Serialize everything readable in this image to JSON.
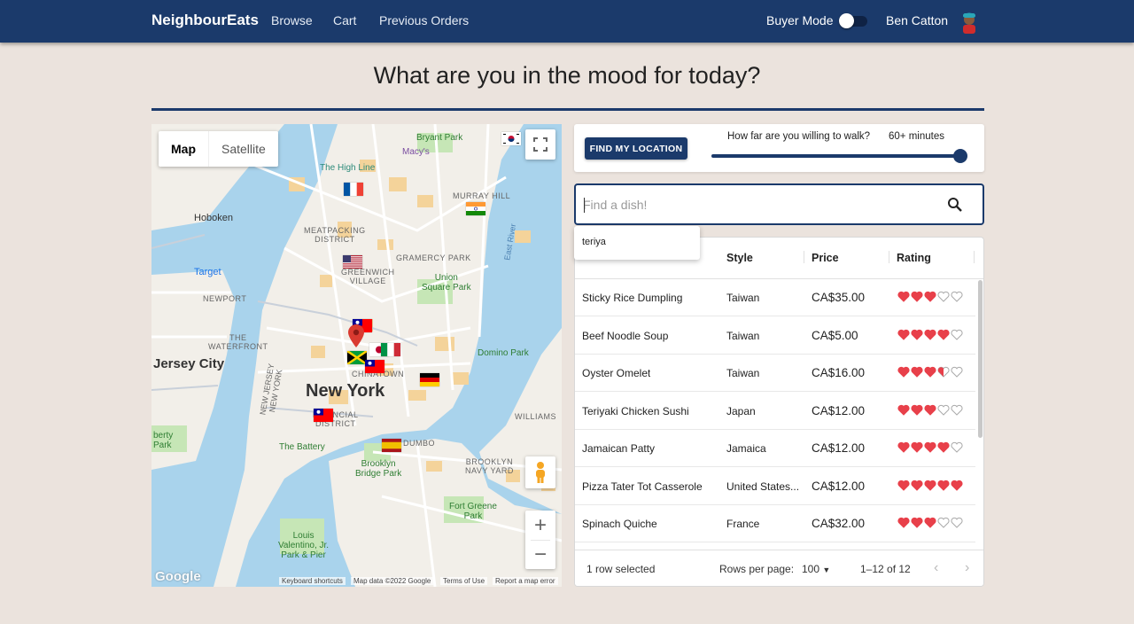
{
  "nav": {
    "brand": "NeighbourEats",
    "links": [
      "Browse",
      "Cart",
      "Previous Orders"
    ],
    "mode_label": "Buyer Mode",
    "mode_on": true,
    "user_name": "Ben Catton",
    "avatar_icon": "user-avatar-icon"
  },
  "title": "What are you in the mood for today?",
  "map": {
    "type_map": "Map",
    "type_satellite": "Satellite",
    "labels": {
      "hoboken": "Hoboken",
      "jersey_city": "Jersey City",
      "new_york": "New York",
      "high_line": "The High Line",
      "macys": "Macy's",
      "bryant_park": "Bryant Park",
      "murray_hill": "MURRAY HILL",
      "meatpacking": "MEATPACKING\nDISTRICT",
      "gramercy": "GRAMERCY PARK",
      "target": "Target",
      "greenwich": "GREENWICH\nVILLAGE",
      "union_square": "Union\nSquare Park",
      "east_river": "East River",
      "newport": "NEWPORT",
      "waterfront": "THE\nWATERFRONT",
      "chinatown": "CHINATOWN",
      "domino": "Domino Park",
      "financial": "FINANCIAL\nDISTRICT",
      "new_jersey": "NEW JERSEY\nNEW YORK",
      "battery": "The Battery",
      "dumbo": "DUMBO",
      "brooklyn_bridge": "Brooklyn\nBridge Park",
      "navy_yard": "BROOKLYN\nNAVY YARD",
      "williams": "WILLIAMS",
      "fort_greene": "Fort Greene\nPark",
      "liberty": "berty\nPark",
      "louis": "Louis\nValentino, Jr.\nPark & Pier"
    },
    "attribution": {
      "shortcuts": "Keyboard shortcuts",
      "data": "Map data ©2022 Google",
      "terms": "Terms of Use",
      "report": "Report a map error",
      "logo": "Google"
    }
  },
  "filters": {
    "locate_label": "FIND MY LOCATION",
    "walk_label": "How far are you willing to walk?",
    "walk_value": "60+ minutes",
    "walk_fraction": 1.0
  },
  "search": {
    "placeholder": "Find a dish!",
    "value": "",
    "suggestion": "teriya"
  },
  "table": {
    "headers": [
      "Style",
      "Price",
      "Rating"
    ],
    "rows": [
      {
        "name": "Sticky Rice Dumpling",
        "style": "Taiwan",
        "price": "CA$35.00",
        "rating": 3
      },
      {
        "name": "Beef Noodle Soup",
        "style": "Taiwan",
        "price": "CA$5.00",
        "rating": 4
      },
      {
        "name": "Oyster Omelet",
        "style": "Taiwan",
        "price": "CA$16.00",
        "rating": 3.5
      },
      {
        "name": "Teriyaki Chicken Sushi",
        "style": "Japan",
        "price": "CA$12.00",
        "rating": 3
      },
      {
        "name": "Jamaican Patty",
        "style": "Jamaica",
        "price": "CA$12.00",
        "rating": 4
      },
      {
        "name": "Pizza Tater Tot Casserole",
        "style": "United States...",
        "price": "CA$12.00",
        "rating": 5
      },
      {
        "name": "Spinach Quiche",
        "style": "France",
        "price": "CA$32.00",
        "rating": 3
      }
    ],
    "footer": {
      "selected": "1 row selected",
      "rows_per_page_label": "Rows per page:",
      "rows_per_page": "100",
      "range": "1–12 of 12"
    }
  },
  "colors": {
    "navy": "#1b3a6b",
    "heart": "#e8404a",
    "background": "#ebe3dd"
  }
}
